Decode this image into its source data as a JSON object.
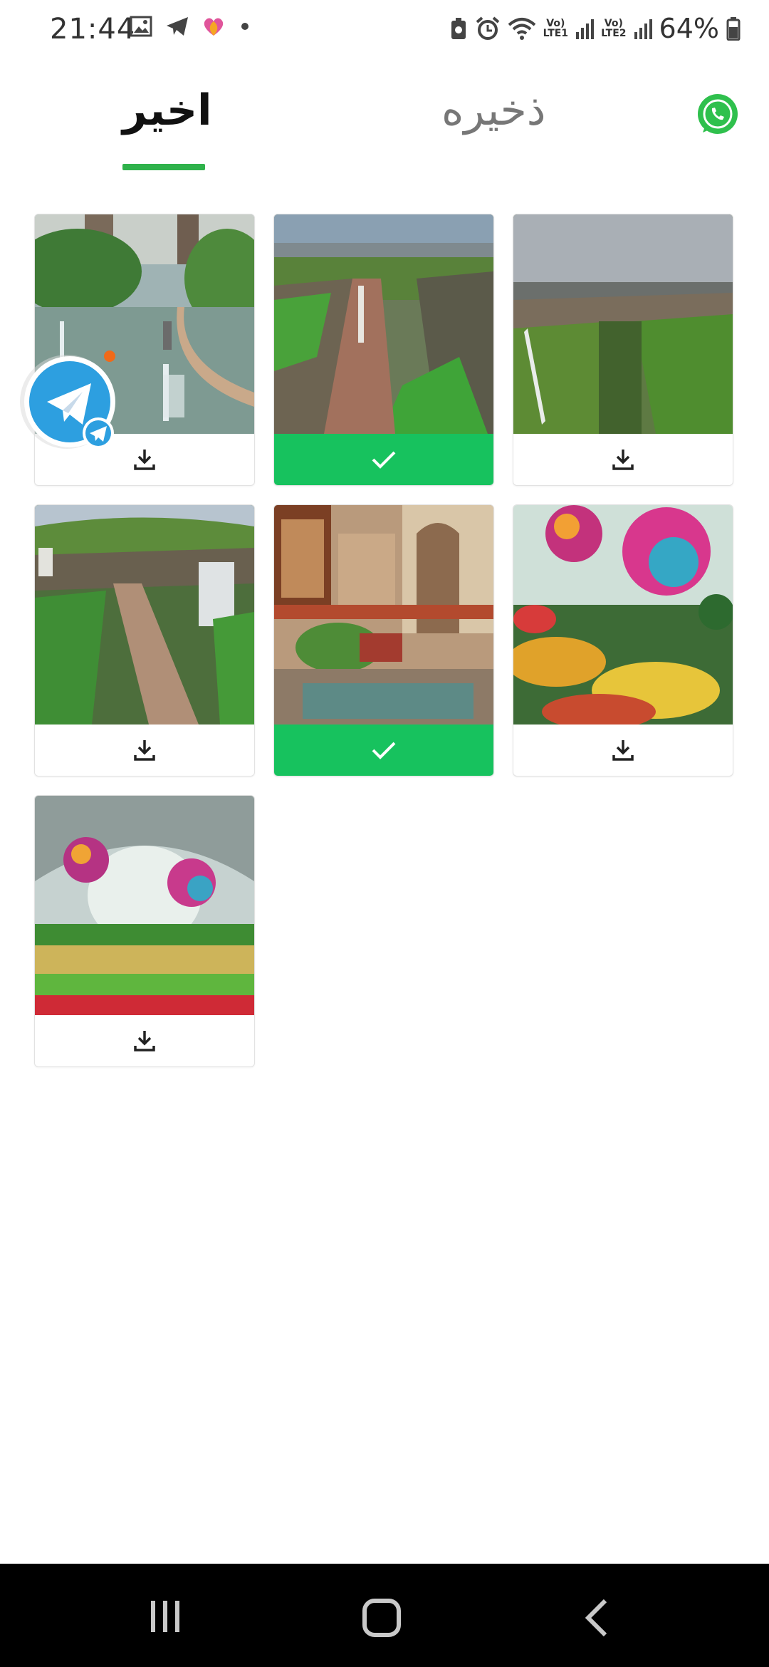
{
  "status_bar": {
    "time": "21:44",
    "battery": "64%",
    "net1": "Vo)\nLTE1",
    "net2": "Vo)\nLTE2",
    "icons": [
      "gallery-icon",
      "telegram-icon",
      "heart-app-icon",
      "dot-icon",
      "battery-saver-icon",
      "alarm-icon",
      "wifi-icon",
      "signal-icon",
      "signal-icon",
      "battery-icon"
    ]
  },
  "header": {
    "tab_recent": "اخیر",
    "tab_saved": "ذخیره",
    "whatsapp_icon": "whatsapp-icon",
    "accent": "#2fb24b"
  },
  "grid": {
    "items": [
      {
        "scene": "garden-lake",
        "selected": false
      },
      {
        "scene": "canyon-waterfall",
        "selected": true
      },
      {
        "scene": "canyon-wide",
        "selected": false
      },
      {
        "scene": "waterfall-cliff",
        "selected": false
      },
      {
        "scene": "persian-courtyard",
        "selected": true
      },
      {
        "scene": "flower-balls",
        "selected": false
      },
      {
        "scene": "flower-dome",
        "selected": false
      }
    ],
    "selected_color": "#17c25e"
  },
  "floating": {
    "icon": "telegram-bubble-icon"
  },
  "navbar": {
    "icons": [
      "recents-icon",
      "home-icon",
      "back-icon"
    ]
  }
}
